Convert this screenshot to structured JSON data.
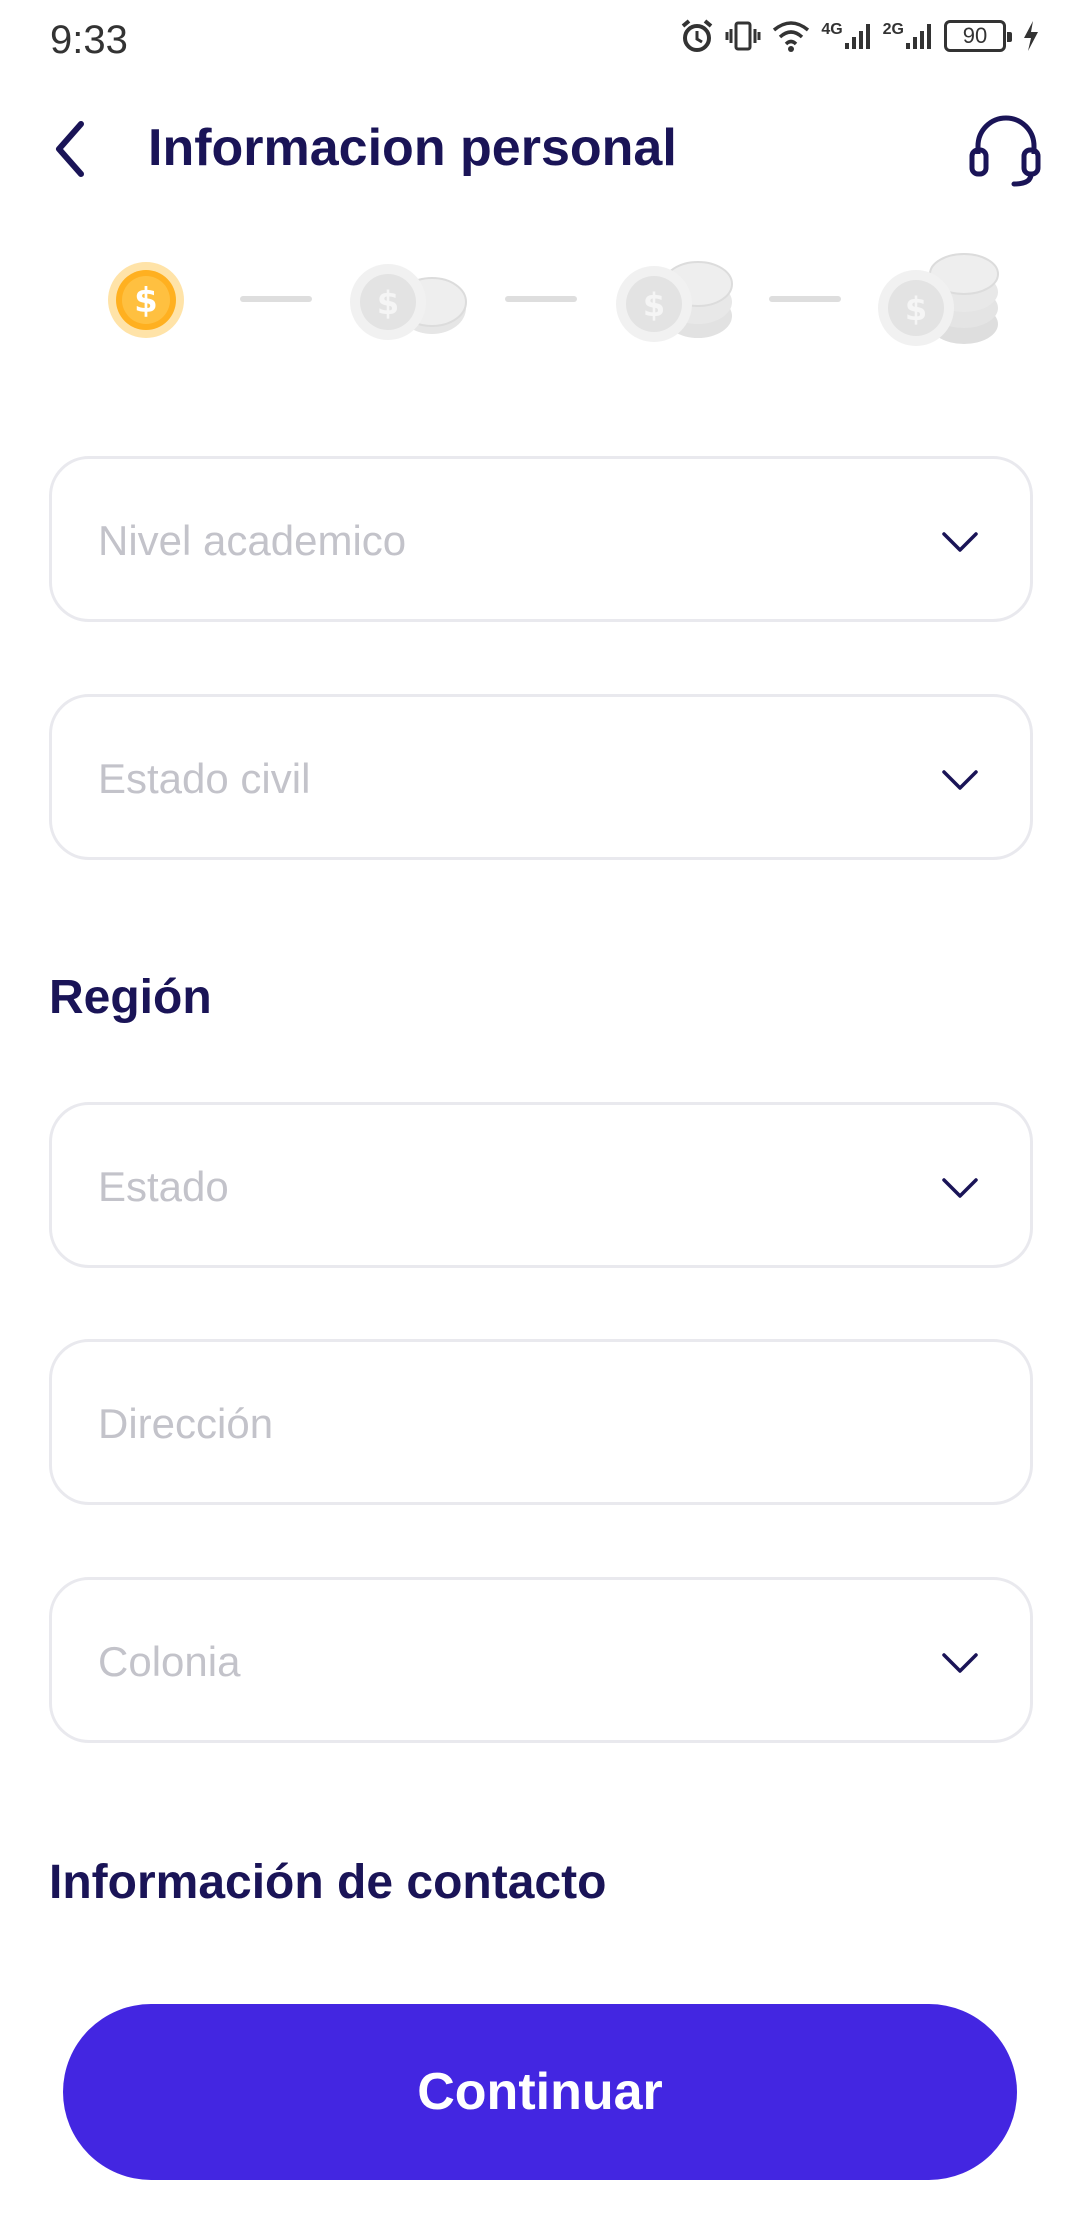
{
  "status_bar": {
    "time": "9:33",
    "network_4g": "4G",
    "network_2g": "2G",
    "battery_level": "90"
  },
  "header": {
    "title": "Informacion personal"
  },
  "progress": {
    "total_steps": 4,
    "current_step": 1,
    "active_color": "#FFB020",
    "inactive_color": "#E6E6E6"
  },
  "form": {
    "nivel_academico_placeholder": "Nivel academico",
    "estado_civil_placeholder": "Estado civil",
    "region_title": "Región",
    "estado_placeholder": "Estado",
    "direccion_placeholder": "Dirección",
    "colonia_placeholder": "Colonia",
    "contact_title": "Información de contacto"
  },
  "actions": {
    "continue_label": "Continuar"
  },
  "colors": {
    "primary": "#4326E1",
    "title": "#1A1457",
    "placeholder": "#C3C3CA",
    "field_border": "#E9E9EE"
  }
}
